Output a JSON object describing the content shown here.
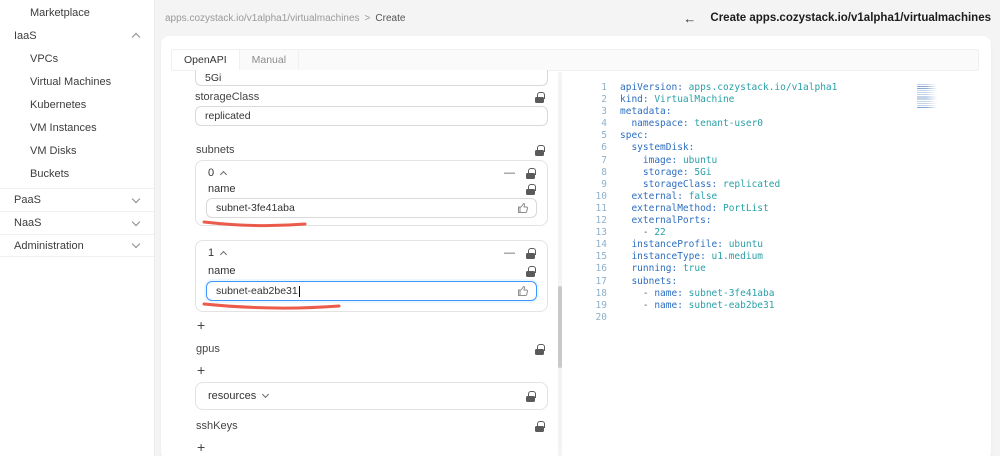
{
  "sidebar": {
    "items": [
      {
        "label": "Marketplace"
      },
      {
        "label": "IaaS"
      },
      {
        "label": "VPCs"
      },
      {
        "label": "Virtual Machines"
      },
      {
        "label": "Kubernetes"
      },
      {
        "label": "VM Instances"
      },
      {
        "label": "VM Disks"
      },
      {
        "label": "Buckets"
      },
      {
        "label": "PaaS"
      },
      {
        "label": "NaaS"
      },
      {
        "label": "Administration"
      }
    ]
  },
  "header": {
    "breadcrumb_path": "apps.cozystack.io/v1alpha1/virtualmachines",
    "breadcrumb_separator": ">",
    "breadcrumb_current": "Create",
    "back_arrow": "←",
    "page_title": "Create apps.cozystack.io/v1alpha1/virtualmachines"
  },
  "tabs": {
    "openapi": "OpenAPI",
    "manual": "Manual"
  },
  "form": {
    "top_partial_value": "5Gi",
    "storage_class": {
      "label": "storageClass",
      "value": "replicated"
    },
    "subnets": {
      "label": "subnets",
      "add_label": "+",
      "items": [
        {
          "index": "0",
          "field_label": "name",
          "value": "subnet-3fe41aba"
        },
        {
          "index": "1",
          "field_label": "name",
          "value": "subnet-eab2be31"
        }
      ]
    },
    "gpus": {
      "label": "gpus",
      "add_label": "+"
    },
    "resources": {
      "label": "resources"
    },
    "ssh_keys": {
      "label": "sshKeys",
      "add_label": "+"
    }
  },
  "icons": {
    "minus": "—"
  },
  "editor": {
    "colors": {
      "key": "#2e6fc0",
      "val": "#2aa0a8",
      "plain": "#5a5a5a",
      "ln": "#8fb0c9"
    },
    "lines": [
      {
        "num": "1",
        "segs": [
          [
            "k",
            "apiVersion:"
          ],
          [
            "v",
            " apps.cozystack.io/v1alpha1"
          ]
        ]
      },
      {
        "num": "2",
        "segs": [
          [
            "k",
            "kind:"
          ],
          [
            "v",
            " VirtualMachine"
          ]
        ]
      },
      {
        "num": "3",
        "segs": [
          [
            "k",
            "metadata:"
          ]
        ]
      },
      {
        "num": "4",
        "segs": [
          [
            "p",
            "  "
          ],
          [
            "k",
            "namespace:"
          ],
          [
            "v",
            " tenant-user0"
          ]
        ]
      },
      {
        "num": "5",
        "segs": [
          [
            "k",
            "spec:"
          ]
        ]
      },
      {
        "num": "6",
        "segs": [
          [
            "p",
            "  "
          ],
          [
            "k",
            "systemDisk:"
          ]
        ]
      },
      {
        "num": "7",
        "segs": [
          [
            "p",
            "    "
          ],
          [
            "k",
            "image:"
          ],
          [
            "v",
            " ubuntu"
          ]
        ]
      },
      {
        "num": "8",
        "segs": [
          [
            "p",
            "    "
          ],
          [
            "k",
            "storage:"
          ],
          [
            "v",
            " 5Gi"
          ]
        ]
      },
      {
        "num": "9",
        "segs": [
          [
            "p",
            "    "
          ],
          [
            "k",
            "storageClass:"
          ],
          [
            "v",
            " replicated"
          ]
        ]
      },
      {
        "num": "10",
        "segs": [
          [
            "p",
            "  "
          ],
          [
            "k",
            "external:"
          ],
          [
            "v",
            " false"
          ]
        ]
      },
      {
        "num": "11",
        "segs": [
          [
            "p",
            "  "
          ],
          [
            "k",
            "externalMethod:"
          ],
          [
            "v",
            " PortList"
          ]
        ]
      },
      {
        "num": "12",
        "segs": [
          [
            "p",
            "  "
          ],
          [
            "k",
            "externalPorts:"
          ]
        ]
      },
      {
        "num": "13",
        "segs": [
          [
            "p",
            "    - "
          ],
          [
            "v",
            "22"
          ]
        ]
      },
      {
        "num": "14",
        "segs": [
          [
            "p",
            "  "
          ],
          [
            "k",
            "instanceProfile:"
          ],
          [
            "v",
            " ubuntu"
          ]
        ]
      },
      {
        "num": "15",
        "segs": [
          [
            "p",
            "  "
          ],
          [
            "k",
            "instanceType:"
          ],
          [
            "v",
            " u1.medium"
          ]
        ]
      },
      {
        "num": "16",
        "segs": [
          [
            "p",
            "  "
          ],
          [
            "k",
            "running:"
          ],
          [
            "v",
            " true"
          ]
        ]
      },
      {
        "num": "17",
        "segs": [
          [
            "p",
            "  "
          ],
          [
            "k",
            "subnets:"
          ]
        ]
      },
      {
        "num": "18",
        "segs": [
          [
            "p",
            "    - "
          ],
          [
            "k",
            "name:"
          ],
          [
            "v",
            " subnet-3fe41aba"
          ]
        ]
      },
      {
        "num": "19",
        "segs": [
          [
            "p",
            "    - "
          ],
          [
            "k",
            "name:"
          ],
          [
            "v",
            " subnet-eab2be31"
          ]
        ]
      },
      {
        "num": "20",
        "segs": []
      }
    ]
  }
}
